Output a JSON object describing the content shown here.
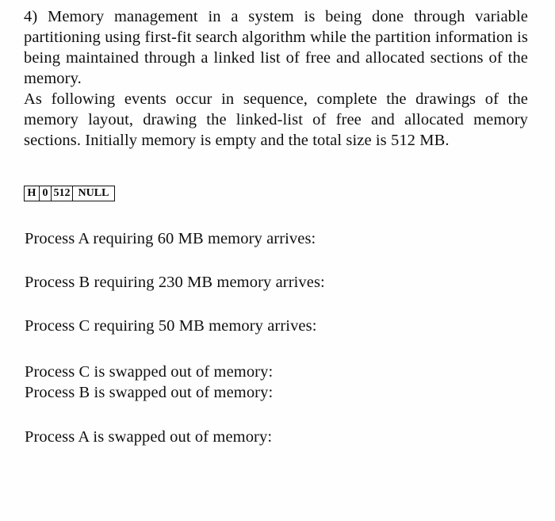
{
  "document": {
    "question_number": "4)",
    "paragraphs": [
      "4) Memory management in a system is being done through variable partitioning using first-fit search algorithm while the partition information is being maintained through a linked list of free and allocated sections of the memory.",
      "As following events occur in sequence, complete the drawings of the memory layout, drawing the linked-list of free and allocated memory sections. Initially memory is empty and the total size is 512 MB."
    ],
    "linked_list_node": {
      "label": "initial-free-list",
      "cells": [
        {
          "name": "head-pointer",
          "value": "H"
        },
        {
          "name": "start-address",
          "value": "0"
        },
        {
          "name": "size-mb",
          "value": "512"
        },
        {
          "name": "next-pointer",
          "value": "NULL"
        }
      ]
    },
    "events": [
      "Process A requiring 60 MB memory arrives:",
      "Process B requiring 230 MB memory arrives:",
      "Process C requiring 50 MB memory arrives:",
      "Process C is swapped out of memory:",
      "Process B is swapped out of memory:",
      "Process A is swapped out of memory:"
    ]
  },
  "style": {
    "page_background": "#fefefe",
    "text_color": "#101010",
    "box_border_color": "#111111"
  }
}
